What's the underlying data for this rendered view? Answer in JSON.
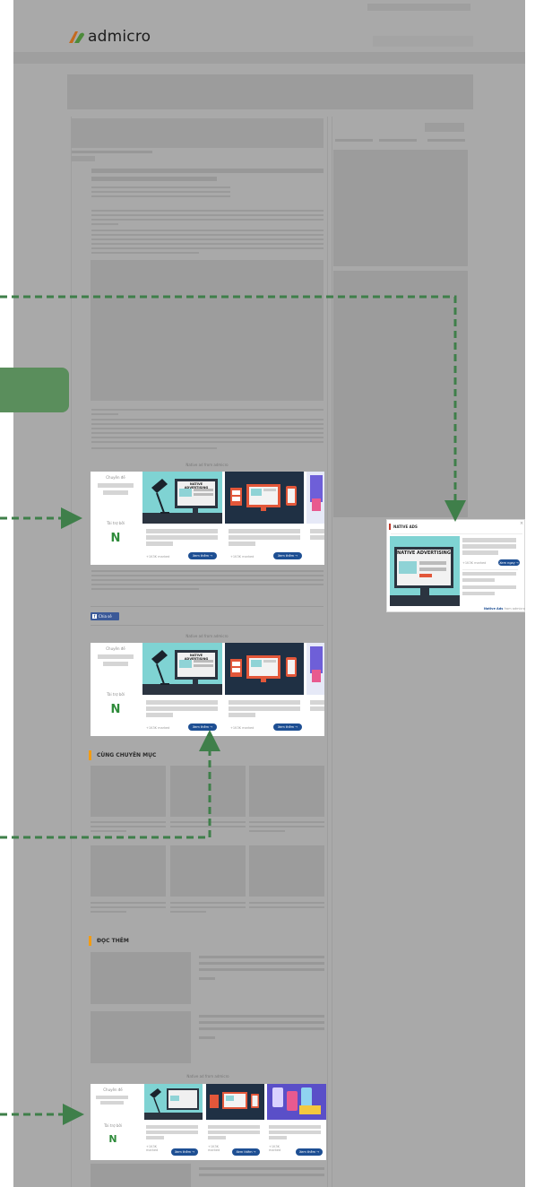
{
  "brand": {
    "name": "admicro"
  },
  "ad_label": "Native ad from admicro",
  "ad_card": {
    "topic_caption": "Chuyên đề",
    "sponsor_caption": "Tài trợ bởi",
    "more_button": "Xem thêm →",
    "views": "+1K3K marked",
    "views_short": "+1K3K\nmarked"
  },
  "share": {
    "label": "Chia sẻ"
  },
  "sections": {
    "related": "CÙNG CHUYÊN MỤC",
    "read_more": "ĐỌC THÊM"
  },
  "native_widget": {
    "title": "NATIVE ADS",
    "image_title": "NATIVE ADVERTISING",
    "cta": "Xem ngay →",
    "footer_brand": "Native Ads",
    "footer_suffix": "from admicro",
    "close": "×"
  },
  "illustration_text": "NATIVE ADVERTISING",
  "colors": {
    "page_overlay": "#a9a9a9",
    "accent_green": "#5a8e5c",
    "arrow": "#3f7f4a",
    "button_blue": "#1e4f93",
    "section_bar": "#f39c12"
  }
}
